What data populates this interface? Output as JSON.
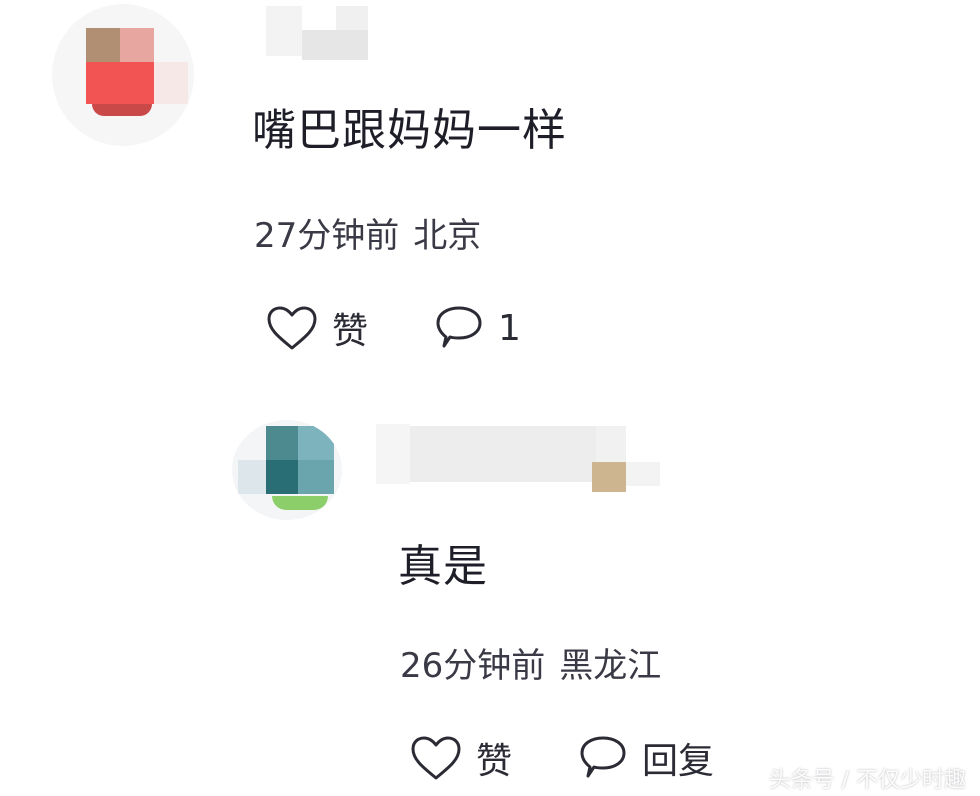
{
  "comments": [
    {
      "text": "嘴巴跟妈妈一样",
      "time": "27分钟前",
      "location": "北京",
      "like_label": "赞",
      "reply_count": "1"
    },
    {
      "text": "真是",
      "time": "26分钟前",
      "location": "黑龙江",
      "like_label": "赞",
      "reply_label": "回复"
    }
  ],
  "watermark": "头条号 / 不仅少时趣",
  "icons": {
    "like": "heart-outline-icon",
    "comment": "speech-bubble-icon"
  },
  "colors": {
    "text": "#1e1e28",
    "meta": "#3a3a46",
    "avatar1_main": "#f05a5a",
    "avatar2_main": "#2f7f86"
  }
}
